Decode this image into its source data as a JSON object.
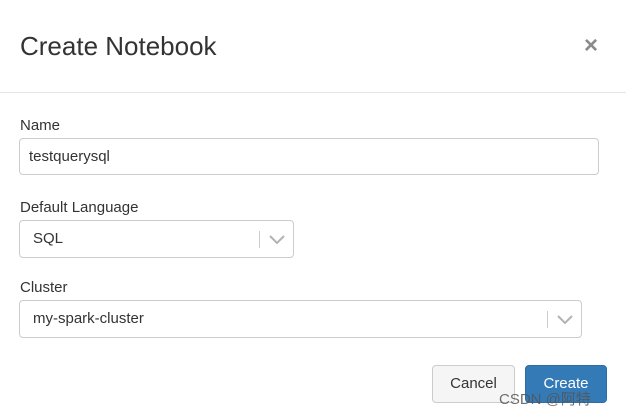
{
  "dialog": {
    "title": "Create Notebook",
    "close_symbol": "×"
  },
  "form": {
    "name_label": "Name",
    "name_value": "testquerysql",
    "language_label": "Default Language",
    "language_value": "SQL",
    "cluster_label": "Cluster",
    "cluster_value": "my-spark-cluster"
  },
  "buttons": {
    "cancel_label": "Cancel",
    "create_label": "Create"
  },
  "watermark": "CSDN @阿特",
  "colors": {
    "primary": "#337ab7",
    "border": "#cccccc",
    "text": "#333333"
  },
  "icons": {
    "close": "close-icon",
    "dropdown": "chevron-down-icon"
  }
}
